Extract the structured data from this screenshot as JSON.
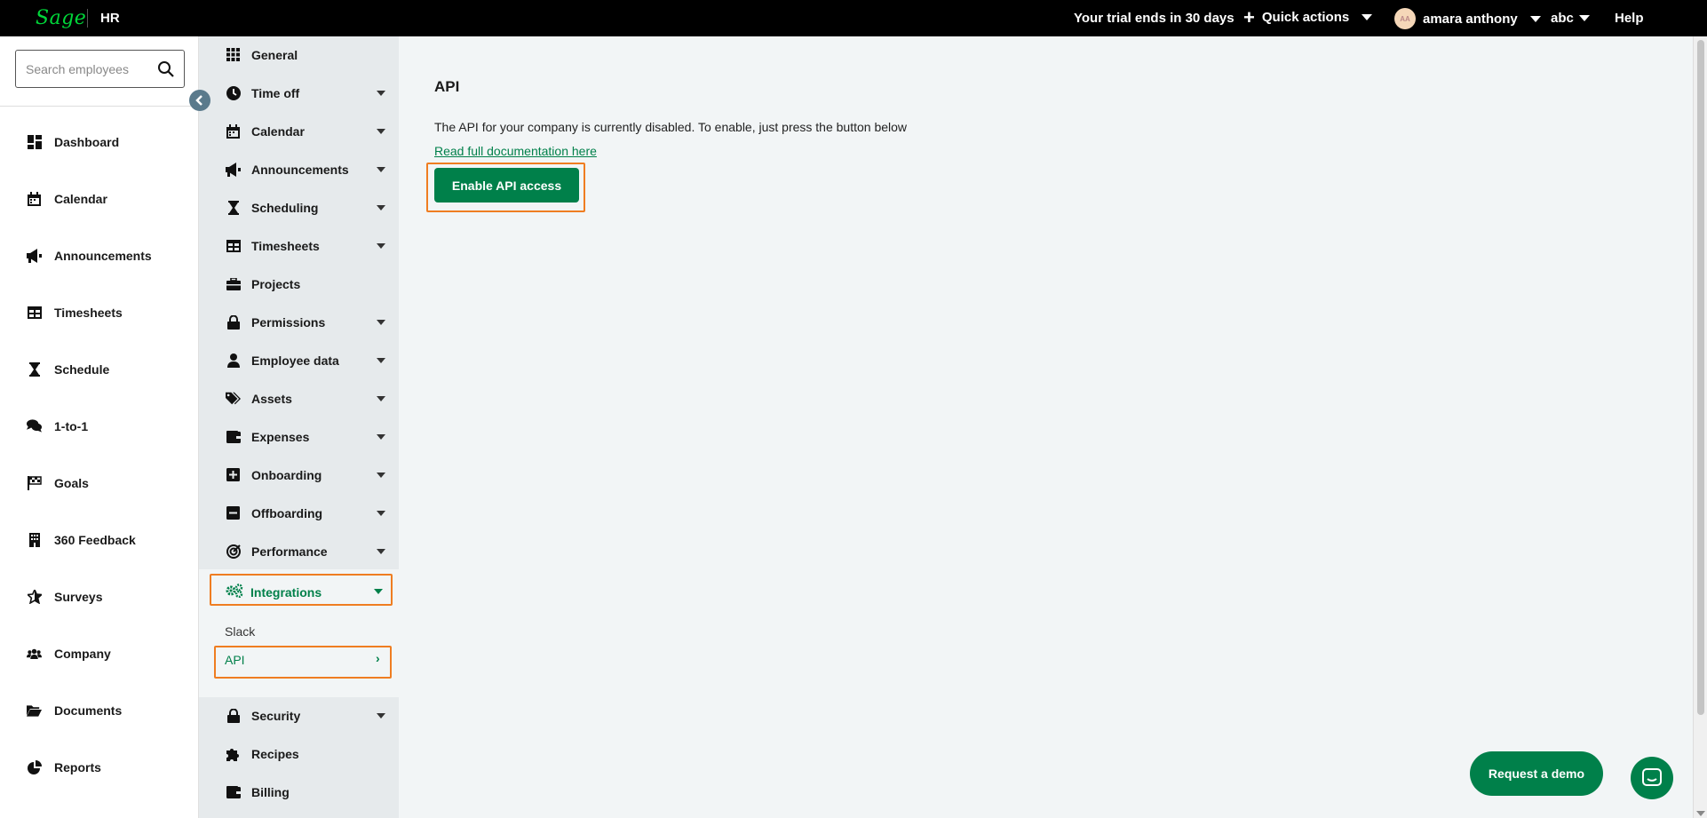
{
  "topbar": {
    "logo": "Sage",
    "product": "HR",
    "trial": "Your trial ends in 30 days",
    "quick_actions": "Quick actions",
    "user_name": "amara anthony",
    "avatar_initials": "AA",
    "company": "abc",
    "help": "Help"
  },
  "search": {
    "placeholder": "Search employees"
  },
  "sidebar": {
    "items": [
      {
        "label": "Dashboard",
        "icon": "dashboard-icon"
      },
      {
        "label": "Calendar",
        "icon": "calendar-icon"
      },
      {
        "label": "Announcements",
        "icon": "megaphone-icon"
      },
      {
        "label": "Timesheets",
        "icon": "table-icon"
      },
      {
        "label": "Schedule",
        "icon": "hourglass-icon"
      },
      {
        "label": "1-to-1",
        "icon": "chat-icon"
      },
      {
        "label": "Goals",
        "icon": "flag-icon"
      },
      {
        "label": "360 Feedback",
        "icon": "building-icon"
      },
      {
        "label": "Surveys",
        "icon": "star-icon"
      },
      {
        "label": "Company",
        "icon": "people-icon"
      },
      {
        "label": "Documents",
        "icon": "folder-icon"
      },
      {
        "label": "Reports",
        "icon": "pie-chart-icon"
      }
    ]
  },
  "settings": {
    "items": [
      {
        "label": "General",
        "icon": "grid-icon"
      },
      {
        "label": "Time off",
        "icon": "clock-icon"
      },
      {
        "label": "Calendar",
        "icon": "calendar-icon"
      },
      {
        "label": "Announcements",
        "icon": "megaphone-icon"
      },
      {
        "label": "Scheduling",
        "icon": "hourglass-icon"
      },
      {
        "label": "Timesheets",
        "icon": "table-icon"
      },
      {
        "label": "Projects",
        "icon": "briefcase-icon"
      },
      {
        "label": "Permissions",
        "icon": "lock-icon"
      },
      {
        "label": "Employee data",
        "icon": "person-icon"
      },
      {
        "label": "Assets",
        "icon": "tags-icon"
      },
      {
        "label": "Expenses",
        "icon": "wallet-icon"
      },
      {
        "label": "Onboarding",
        "icon": "plus-square-icon"
      },
      {
        "label": "Offboarding",
        "icon": "minus-square-icon"
      },
      {
        "label": "Performance",
        "icon": "target-icon"
      }
    ],
    "integrations": {
      "label": "Integrations",
      "sub": [
        "Slack",
        "API"
      ]
    },
    "bottom_items": [
      {
        "label": "Security",
        "icon": "lock-icon"
      },
      {
        "label": "Recipes",
        "icon": "puzzle-icon"
      },
      {
        "label": "Billing",
        "icon": "wallet-icon"
      }
    ]
  },
  "main": {
    "title": "API",
    "description": "The API for your company is currently disabled. To enable, just press the button below",
    "doc_link": "Read full documentation here",
    "enable_button": "Enable API access"
  },
  "floating": {
    "demo_button": "Request a demo"
  },
  "colors": {
    "brand_green": "#00804a",
    "logo_green": "#00d639",
    "highlight": "#ef7d21"
  }
}
